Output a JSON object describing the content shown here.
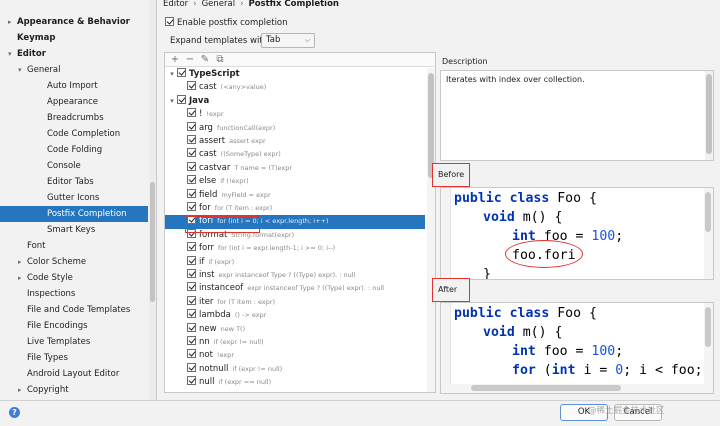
{
  "sidebar": {
    "items": [
      {
        "label": "Appearance & Behavior",
        "level": 0,
        "arrow": "▸",
        "bold": true
      },
      {
        "label": "Keymap",
        "level": 0,
        "arrow": "",
        "bold": true
      },
      {
        "label": "Editor",
        "level": 0,
        "arrow": "▾",
        "bold": true
      },
      {
        "label": "General",
        "level": 1,
        "arrow": "▾"
      },
      {
        "label": "Auto Import",
        "level": 2,
        "arrow": ""
      },
      {
        "label": "Appearance",
        "level": 2,
        "arrow": ""
      },
      {
        "label": "Breadcrumbs",
        "level": 2,
        "arrow": ""
      },
      {
        "label": "Code Completion",
        "level": 2,
        "arrow": ""
      },
      {
        "label": "Code Folding",
        "level": 2,
        "arrow": ""
      },
      {
        "label": "Console",
        "level": 2,
        "arrow": ""
      },
      {
        "label": "Editor Tabs",
        "level": 2,
        "arrow": ""
      },
      {
        "label": "Gutter Icons",
        "level": 2,
        "arrow": ""
      },
      {
        "label": "Postfix Completion",
        "level": 2,
        "arrow": "",
        "selected": true
      },
      {
        "label": "Smart Keys",
        "level": 2,
        "arrow": ""
      },
      {
        "label": "Font",
        "level": 1,
        "arrow": ""
      },
      {
        "label": "Color Scheme",
        "level": 1,
        "arrow": "▸"
      },
      {
        "label": "Code Style",
        "level": 1,
        "arrow": "▸"
      },
      {
        "label": "Inspections",
        "level": 1,
        "arrow": ""
      },
      {
        "label": "File and Code Templates",
        "level": 1,
        "arrow": ""
      },
      {
        "label": "File Encodings",
        "level": 1,
        "arrow": ""
      },
      {
        "label": "Live Templates",
        "level": 1,
        "arrow": ""
      },
      {
        "label": "File Types",
        "level": 1,
        "arrow": ""
      },
      {
        "label": "Android Layout Editor",
        "level": 1,
        "arrow": ""
      },
      {
        "label": "Copyright",
        "level": 1,
        "arrow": "▸"
      }
    ]
  },
  "breadcrumb": {
    "part1": "Editor",
    "sep": "›",
    "part2": "General",
    "part3": "Postfix Completion"
  },
  "options": {
    "enable_label": "Enable postfix completion",
    "expand_label": "Expand templates with",
    "expand_value": "Tab"
  },
  "toolbar": {
    "add": "+",
    "remove": "−",
    "edit": "✎",
    "copy": "⧉"
  },
  "tree": [
    {
      "key": "TypeScript",
      "desc": "",
      "group": true,
      "expander": "▾"
    },
    {
      "key": "cast",
      "desc": "(<any>value)"
    },
    {
      "key": "Java",
      "desc": "",
      "group": true,
      "expander": "▾"
    },
    {
      "key": "!",
      "desc": "!expr"
    },
    {
      "key": "arg",
      "desc": "functionCall(expr)"
    },
    {
      "key": "assert",
      "desc": "assert expr"
    },
    {
      "key": "cast",
      "desc": "((SomeType) expr)"
    },
    {
      "key": "castvar",
      "desc": "T name = (T)expr"
    },
    {
      "key": "else",
      "desc": "if (!expr)"
    },
    {
      "key": "field",
      "desc": "myField = expr"
    },
    {
      "key": "for",
      "desc": "for (T item : expr)"
    },
    {
      "key": "fori",
      "desc": "for (int i = 0; i < expr.length; i++)",
      "selected": true
    },
    {
      "key": "format",
      "desc": "String.format(expr)"
    },
    {
      "key": "forr",
      "desc": "for (int i = expr.length-1; i >= 0; i--)"
    },
    {
      "key": "if",
      "desc": "if (expr)"
    },
    {
      "key": "inst",
      "desc": "expr instanceof Type ? ((Type) expr). : null"
    },
    {
      "key": "instanceof",
      "desc": "expr instanceof Type ? ((Type) expr). : null"
    },
    {
      "key": "iter",
      "desc": "for (T item : expr)"
    },
    {
      "key": "lambda",
      "desc": "() -> expr"
    },
    {
      "key": "new",
      "desc": "new T()"
    },
    {
      "key": "nn",
      "desc": "if (expr != null)"
    },
    {
      "key": "not",
      "desc": "!expr"
    },
    {
      "key": "notnull",
      "desc": "if (expr != null)"
    },
    {
      "key": "null",
      "desc": "if (expr == null)"
    }
  ],
  "description": {
    "label": "Description",
    "text": "Iterates with index over collection."
  },
  "before": {
    "label": "Before",
    "lines": {
      "l1_kw1": "public",
      "l1_kw2": "class",
      "l1_rest": " Foo {",
      "l2_kw": "void",
      "l2_rest": " m() {",
      "l3_kw": "int",
      "l3_mid": " foo = ",
      "l3_num": "100",
      "l3_end": ";",
      "l4": "foo.fori",
      "l5": "}"
    }
  },
  "after": {
    "label": "After",
    "lines": {
      "l1_kw1": "public",
      "l1_kw2": "class",
      "l1_rest": " Foo {",
      "l2_kw": "void",
      "l2_rest": " m() {",
      "l3_kw": "int",
      "l3_mid": " foo = ",
      "l3_num": "100",
      "l3_end": ";",
      "l4_kw1": "for",
      "l4_a": " (",
      "l4_kw2": "int",
      "l4_b": " i = ",
      "l4_num": "0",
      "l4_c": "; i < foo; i++"
    }
  },
  "buttons": {
    "ok": "OK",
    "cancel": "Cancel",
    "help": "?"
  },
  "watermark": "@稀土掘金技术社区"
}
